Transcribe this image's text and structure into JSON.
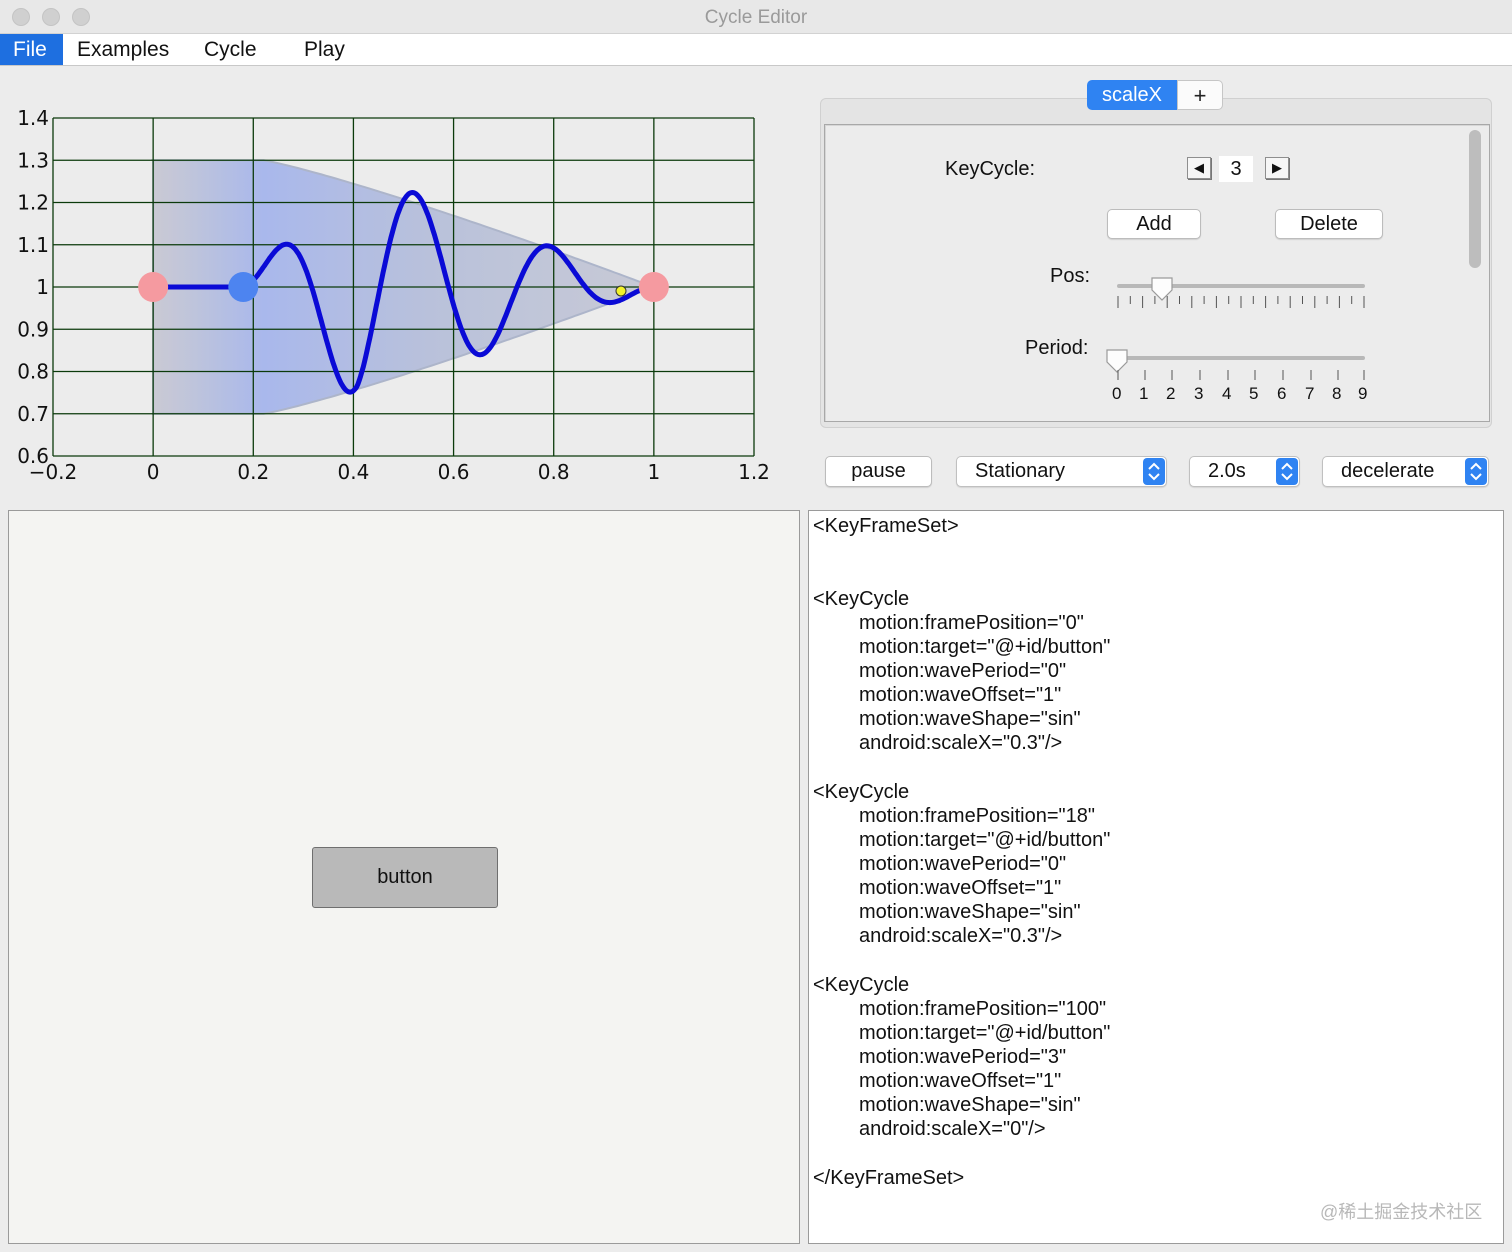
{
  "window": {
    "title": "Cycle Editor"
  },
  "menu": {
    "items": [
      "File",
      "Examples",
      "Cycle",
      "Play"
    ]
  },
  "graph": {
    "x_ticks": [
      "−0.2",
      "0",
      "0.2",
      "0.4",
      "0.6",
      "0.8",
      "1",
      "1.2"
    ],
    "y_ticks": [
      "1.4",
      "1.3",
      "1.2",
      "1.1",
      "1",
      "0.9",
      "0.8",
      "0.7",
      "0.6"
    ],
    "xlim": [
      -0.2,
      1.2
    ],
    "ylim": [
      0.6,
      1.4
    ],
    "keyframe_positions": [
      0,
      0.18,
      1
    ],
    "selected_keyframe": 0.18,
    "curve_color": "#0a0ad6",
    "keyframe_color": "#f59aa0",
    "selected_color": "#4d84f0",
    "grid_color": "#0b3a0b"
  },
  "tabs": {
    "active": "scaleX",
    "add": "+"
  },
  "panel": {
    "keycycle_label": "KeyCycle:",
    "keycycle_prev": "◀",
    "keycycle_value": "3",
    "keycycle_next": "▶",
    "add_label": "Add",
    "delete_label": "Delete",
    "pos_label": "Pos:",
    "pos_value_percent": 18,
    "period_label": "Period:",
    "period_value": 0,
    "period_ticks": [
      "0",
      "1",
      "2",
      "3",
      "4",
      "5",
      "6",
      "7",
      "8",
      "9"
    ]
  },
  "controls": {
    "pause_label": "pause",
    "mode_value": "Stationary",
    "duration_value": "2.0s",
    "easing_value": "decelerate"
  },
  "preview": {
    "button_label": "button"
  },
  "xml": {
    "lines": [
      {
        "text": "<KeyFrameSet>",
        "indent": false
      },
      {
        "text": "<KeyCycle",
        "indent": false
      },
      {
        "text": "motion:framePosition=\"0\"",
        "indent": true
      },
      {
        "text": "motion:target=\"@+id/button\"",
        "indent": true
      },
      {
        "text": "motion:wavePeriod=\"0\"",
        "indent": true
      },
      {
        "text": "motion:waveOffset=\"1\"",
        "indent": true
      },
      {
        "text": "motion:waveShape=\"sin\"",
        "indent": true
      },
      {
        "text": "android:scaleX=\"0.3\"/>",
        "indent": true
      },
      {
        "text": "<KeyCycle",
        "indent": false
      },
      {
        "text": "motion:framePosition=\"18\"",
        "indent": true
      },
      {
        "text": "motion:target=\"@+id/button\"",
        "indent": true
      },
      {
        "text": "motion:wavePeriod=\"0\"",
        "indent": true
      },
      {
        "text": "motion:waveOffset=\"1\"",
        "indent": true
      },
      {
        "text": "motion:waveShape=\"sin\"",
        "indent": true
      },
      {
        "text": "android:scaleX=\"0.3\"/>",
        "indent": true
      },
      {
        "text": "<KeyCycle",
        "indent": false
      },
      {
        "text": "motion:framePosition=\"100\"",
        "indent": true
      },
      {
        "text": "motion:target=\"@+id/button\"",
        "indent": true
      },
      {
        "text": "motion:wavePeriod=\"3\"",
        "indent": true
      },
      {
        "text": "motion:waveOffset=\"1\"",
        "indent": true
      },
      {
        "text": "motion:waveShape=\"sin\"",
        "indent": true
      },
      {
        "text": "android:scaleX=\"0\"/>",
        "indent": true
      },
      {
        "text": "</KeyFrameSet>",
        "indent": false
      }
    ]
  },
  "watermark": "@稀土掘金技术社区"
}
